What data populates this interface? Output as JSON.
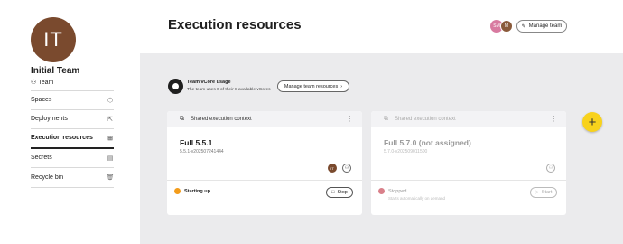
{
  "sidebar": {
    "avatar_initials": "IT",
    "team_name": "Initial Team",
    "team_sub": "Team",
    "items": [
      {
        "label": "Spaces",
        "icon": "spaces-icon"
      },
      {
        "label": "Deployments",
        "icon": "deployments-icon"
      },
      {
        "label": "Execution resources",
        "icon": "execution-resources-icon",
        "active": true
      },
      {
        "label": "Secrets",
        "icon": "secrets-icon"
      },
      {
        "label": "Recycle bin",
        "icon": "trash-icon"
      }
    ]
  },
  "header": {
    "title": "Execution resources",
    "members": [
      "SM",
      "M"
    ],
    "manage_team_label": "Manage team"
  },
  "usage": {
    "title": "Team vCore usage",
    "subtitle": "The team uses 0 of their 8 available vCores",
    "manage_label": "Manage team resources"
  },
  "cards": [
    {
      "header": "Shared execution context",
      "title": "Full 5.5.1",
      "version": "5.5.1-v202507241444",
      "owner_initials": "IT",
      "status": "Starting up...",
      "status_sub": "",
      "action_label": "Stop"
    },
    {
      "header": "Shared execution context",
      "title": "Full 5.7.0 (not assigned)",
      "version": "5.7.0-v202509011500",
      "status": "Stopped",
      "status_sub": "Starts automatically on demand",
      "action_label": "Start"
    }
  ],
  "colors": {
    "accent_fab": "#f8d21c",
    "status_starting": "#f39c1b",
    "status_stopped": "#d9808a",
    "avatar_brown": "#7a4a2e"
  }
}
